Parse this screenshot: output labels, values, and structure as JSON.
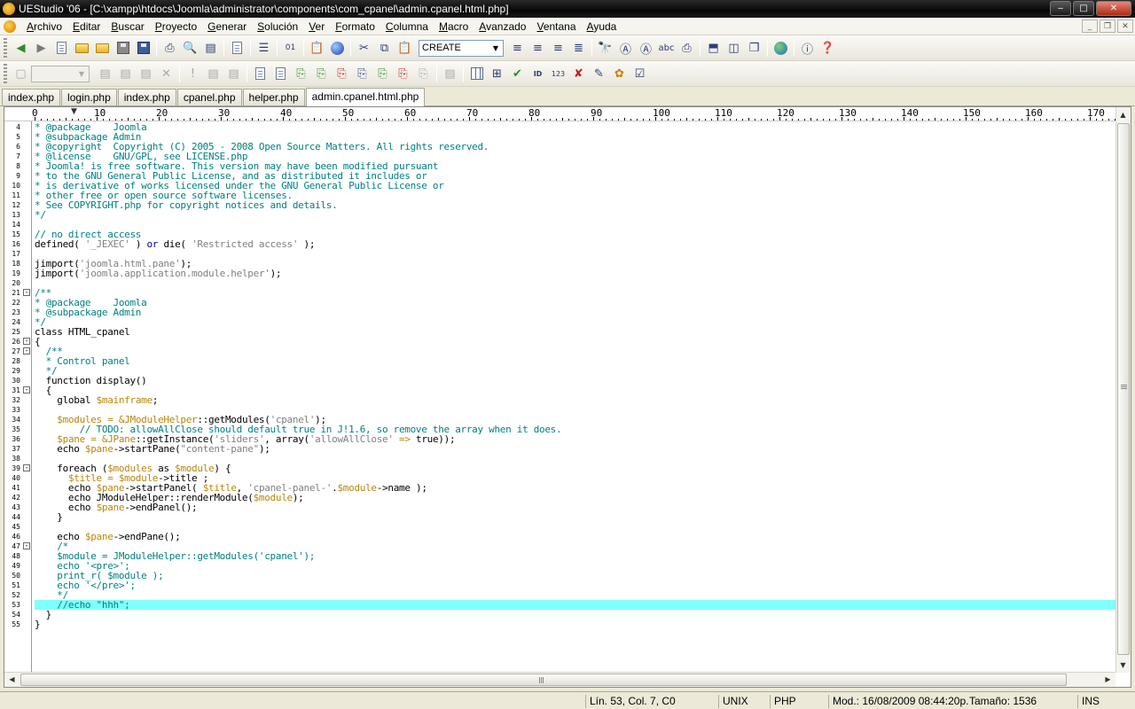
{
  "titlebar": {
    "title": "UEStudio '06 - [C:\\xampp\\htdocs\\Joomla\\administrator\\components\\com_cpanel\\admin.cpanel.html.php]",
    "minimize": "‒",
    "maximize": "□",
    "close": "✕"
  },
  "menu": [
    "Archivo",
    "Editar",
    "Buscar",
    "Proyecto",
    "Generar",
    "Solución",
    "Ver",
    "Formato",
    "Columna",
    "Macro",
    "Avanzado",
    "Ventana",
    "Ayuda"
  ],
  "toolbar": {
    "create_combo": "CREATE"
  },
  "tabs": [
    "index.php",
    "login.php",
    "index.php",
    "cpanel.php",
    "helper.php",
    "admin.cpanel.html.php"
  ],
  "ruler": [
    "0",
    "10",
    "20",
    "30",
    "40",
    "50",
    "60",
    "70",
    "80",
    "90",
    "100",
    "110",
    "120",
    "130",
    "140",
    "150",
    "160",
    "170"
  ],
  "code_lines": [
    {
      "n": "4",
      "segs": [
        {
          "t": "* @package    Joomla",
          "c": "cmt"
        }
      ]
    },
    {
      "n": "5",
      "segs": [
        {
          "t": "* @subpackage Admin",
          "c": "cmt"
        }
      ]
    },
    {
      "n": "6",
      "segs": [
        {
          "t": "* @copyright  Copyright (C) 2005 - 2008 Open Source Matters. All rights reserved.",
          "c": "cmt"
        }
      ]
    },
    {
      "n": "7",
      "segs": [
        {
          "t": "* @license    GNU/GPL, see LICENSE.php",
          "c": "cmt"
        }
      ]
    },
    {
      "n": "8",
      "segs": [
        {
          "t": "* Joomla! is free software. This version may have been modified pursuant",
          "c": "cmt"
        }
      ]
    },
    {
      "n": "9",
      "segs": [
        {
          "t": "* to the GNU General Public License, and as distributed it includes or",
          "c": "cmt"
        }
      ]
    },
    {
      "n": "10",
      "segs": [
        {
          "t": "* is derivative of works licensed under the GNU General Public License or",
          "c": "cmt"
        }
      ]
    },
    {
      "n": "11",
      "segs": [
        {
          "t": "* other free or open source software licenses.",
          "c": "cmt"
        }
      ]
    },
    {
      "n": "12",
      "segs": [
        {
          "t": "* See COPYRIGHT.php for copyright notices and details.",
          "c": "cmt"
        }
      ]
    },
    {
      "n": "13",
      "segs": [
        {
          "t": "*/",
          "c": "cmt"
        }
      ]
    },
    {
      "n": "14",
      "segs": []
    },
    {
      "n": "15",
      "segs": [
        {
          "t": "// no direct access",
          "c": "cmt"
        }
      ]
    },
    {
      "n": "16",
      "segs": [
        {
          "t": "defined( ",
          "c": "op"
        },
        {
          "t": "'_JEXEC'",
          "c": "str"
        },
        {
          "t": " ) ",
          "c": "op"
        },
        {
          "t": "or",
          "c": "kw"
        },
        {
          "t": " die( ",
          "c": "op"
        },
        {
          "t": "'Restricted access'",
          "c": "str"
        },
        {
          "t": " );",
          "c": "op"
        }
      ]
    },
    {
      "n": "17",
      "segs": []
    },
    {
      "n": "18",
      "segs": [
        {
          "t": "jimport(",
          "c": "op"
        },
        {
          "t": "'joomla.html.pane'",
          "c": "str"
        },
        {
          "t": ");",
          "c": "op"
        }
      ]
    },
    {
      "n": "19",
      "segs": [
        {
          "t": "jimport(",
          "c": "op"
        },
        {
          "t": "'joomla.application.module.helper'",
          "c": "str"
        },
        {
          "t": ");",
          "c": "op"
        }
      ]
    },
    {
      "n": "20",
      "segs": []
    },
    {
      "n": "21",
      "fold": "-",
      "segs": [
        {
          "t": "/**",
          "c": "cmt"
        }
      ]
    },
    {
      "n": "22",
      "segs": [
        {
          "t": "* @package    Joomla",
          "c": "cmt"
        }
      ]
    },
    {
      "n": "23",
      "segs": [
        {
          "t": "* @subpackage Admin",
          "c": "cmt"
        }
      ]
    },
    {
      "n": "24",
      "segs": [
        {
          "t": "*/",
          "c": "cmt"
        }
      ]
    },
    {
      "n": "25",
      "segs": [
        {
          "t": "class HTML_cpanel",
          "c": "op"
        }
      ]
    },
    {
      "n": "26",
      "fold": "-",
      "segs": [
        {
          "t": "{",
          "c": "op"
        }
      ]
    },
    {
      "n": "27",
      "fold": "-",
      "segs": [
        {
          "t": "  /**",
          "c": "cmt"
        }
      ]
    },
    {
      "n": "28",
      "segs": [
        {
          "t": "  * Control panel",
          "c": "cmt"
        }
      ]
    },
    {
      "n": "29",
      "segs": [
        {
          "t": "  */",
          "c": "cmt"
        }
      ]
    },
    {
      "n": "30",
      "segs": [
        {
          "t": "  function display()",
          "c": "op"
        }
      ]
    },
    {
      "n": "31",
      "fold": "-",
      "segs": [
        {
          "t": "  {",
          "c": "op"
        }
      ]
    },
    {
      "n": "32",
      "segs": [
        {
          "t": "    global ",
          "c": "op"
        },
        {
          "t": "$mainframe",
          "c": "var"
        },
        {
          "t": ";",
          "c": "op"
        }
      ]
    },
    {
      "n": "33",
      "segs": []
    },
    {
      "n": "34",
      "segs": [
        {
          "t": "    ",
          "c": "op"
        },
        {
          "t": "$modules = &JModuleHelper",
          "c": "var"
        },
        {
          "t": "::getModules(",
          "c": "op"
        },
        {
          "t": "'cpanel'",
          "c": "str"
        },
        {
          "t": ");",
          "c": "op"
        }
      ]
    },
    {
      "n": "35",
      "segs": [
        {
          "t": "        // TODO: allowAllClose should default true in J!1.6, so remove the array when it does.",
          "c": "cmt"
        }
      ]
    },
    {
      "n": "36",
      "segs": [
        {
          "t": "    ",
          "c": "op"
        },
        {
          "t": "$pane = &JPane",
          "c": "var"
        },
        {
          "t": "::getInstance(",
          "c": "op"
        },
        {
          "t": "'sliders'",
          "c": "str"
        },
        {
          "t": ", ",
          "c": "op"
        },
        {
          "t": "array(",
          "c": "op"
        },
        {
          "t": "'allowAllClose'",
          "c": "str"
        },
        {
          "t": " => ",
          "c": "var"
        },
        {
          "t": "true",
          "c": "op"
        },
        {
          "t": "));",
          "c": "op"
        }
      ]
    },
    {
      "n": "37",
      "segs": [
        {
          "t": "    echo ",
          "c": "op"
        },
        {
          "t": "$pane",
          "c": "var"
        },
        {
          "t": "->startPane(",
          "c": "op"
        },
        {
          "t": "\"content-pane\"",
          "c": "str"
        },
        {
          "t": ");",
          "c": "op"
        }
      ]
    },
    {
      "n": "38",
      "segs": []
    },
    {
      "n": "39",
      "fold": "-",
      "segs": [
        {
          "t": "    foreach (",
          "c": "op"
        },
        {
          "t": "$modules",
          "c": "var"
        },
        {
          "t": " as ",
          "c": "op"
        },
        {
          "t": "$module",
          "c": "var"
        },
        {
          "t": ") {",
          "c": "op"
        }
      ]
    },
    {
      "n": "40",
      "segs": [
        {
          "t": "      ",
          "c": "op"
        },
        {
          "t": "$title = $module",
          "c": "var"
        },
        {
          "t": "->title ;",
          "c": "op"
        }
      ]
    },
    {
      "n": "41",
      "segs": [
        {
          "t": "      echo ",
          "c": "op"
        },
        {
          "t": "$pane",
          "c": "var"
        },
        {
          "t": "->startPanel( ",
          "c": "op"
        },
        {
          "t": "$title",
          "c": "var"
        },
        {
          "t": ", ",
          "c": "op"
        },
        {
          "t": "'cpanel-panel-'",
          "c": "str"
        },
        {
          "t": ".",
          "c": "op"
        },
        {
          "t": "$module",
          "c": "var"
        },
        {
          "t": "->name );",
          "c": "op"
        }
      ]
    },
    {
      "n": "42",
      "segs": [
        {
          "t": "      echo JModuleHelper::renderModule(",
          "c": "op"
        },
        {
          "t": "$module",
          "c": "var"
        },
        {
          "t": ");",
          "c": "op"
        }
      ]
    },
    {
      "n": "43",
      "segs": [
        {
          "t": "      echo ",
          "c": "op"
        },
        {
          "t": "$pane",
          "c": "var"
        },
        {
          "t": "->endPanel();",
          "c": "op"
        }
      ]
    },
    {
      "n": "44",
      "segs": [
        {
          "t": "    }",
          "c": "op"
        }
      ]
    },
    {
      "n": "45",
      "segs": []
    },
    {
      "n": "46",
      "segs": [
        {
          "t": "    echo ",
          "c": "op"
        },
        {
          "t": "$pane",
          "c": "var"
        },
        {
          "t": "->endPane();",
          "c": "op"
        }
      ]
    },
    {
      "n": "47",
      "fold": "-",
      "segs": [
        {
          "t": "    /*",
          "c": "cmt"
        }
      ]
    },
    {
      "n": "48",
      "segs": [
        {
          "t": "    $module = JModuleHelper::getModules('cpanel');",
          "c": "cmt"
        }
      ]
    },
    {
      "n": "49",
      "segs": [
        {
          "t": "    echo '<pre>';",
          "c": "cmt"
        }
      ]
    },
    {
      "n": "50",
      "segs": [
        {
          "t": "    print_r( $module );",
          "c": "cmt"
        }
      ]
    },
    {
      "n": "51",
      "segs": [
        {
          "t": "    echo '</pre>';",
          "c": "cmt"
        }
      ]
    },
    {
      "n": "52",
      "segs": [
        {
          "t": "    */",
          "c": "cmt"
        }
      ]
    },
    {
      "n": "53",
      "hl": true,
      "segs": [
        {
          "t": "    //echo \"hhh\";",
          "c": "cmt"
        }
      ]
    },
    {
      "n": "54",
      "segs": [
        {
          "t": "  }",
          "c": "op"
        }
      ]
    },
    {
      "n": "55",
      "segs": [
        {
          "t": "}",
          "c": "op"
        }
      ]
    }
  ],
  "status": {
    "position": "Lín. 53, Col. 7, C0",
    "line_ending": "UNIX",
    "language": "PHP",
    "modified": "Mod.: 16/08/2009 08:44:20p.",
    "size": "Tamaño: 1536",
    "mode": "INS"
  }
}
